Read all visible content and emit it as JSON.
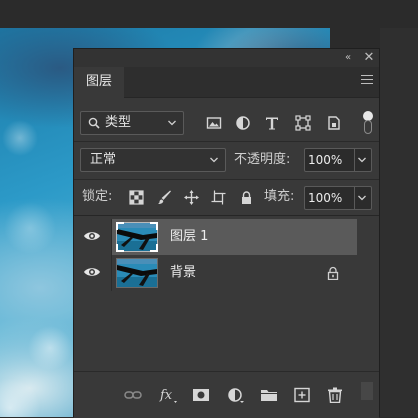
{
  "panel": {
    "tab_label": "图层",
    "collapse_glyph": "«",
    "close_glyph": "✕"
  },
  "filter": {
    "kind_label": "类型",
    "icons": [
      "image-icon",
      "adjustment-icon",
      "type-icon",
      "shape-icon",
      "smart-object-icon"
    ]
  },
  "blend": {
    "mode": "正常",
    "opacity_label": "不透明度:",
    "opacity_value": "100%"
  },
  "lock": {
    "label": "锁定:",
    "fill_label": "填充:",
    "fill_value": "100%"
  },
  "layers": [
    {
      "name": "图层 1",
      "visible": true,
      "selected": true,
      "locked": false
    },
    {
      "name": "背景",
      "visible": true,
      "selected": false,
      "locked": true
    }
  ],
  "bottom_toolbar": {
    "fx_label": "fx"
  },
  "colors": {
    "panel_bg": "#393939",
    "selected_row": "#5a5a5a",
    "field_border": "#5a5a5a"
  }
}
